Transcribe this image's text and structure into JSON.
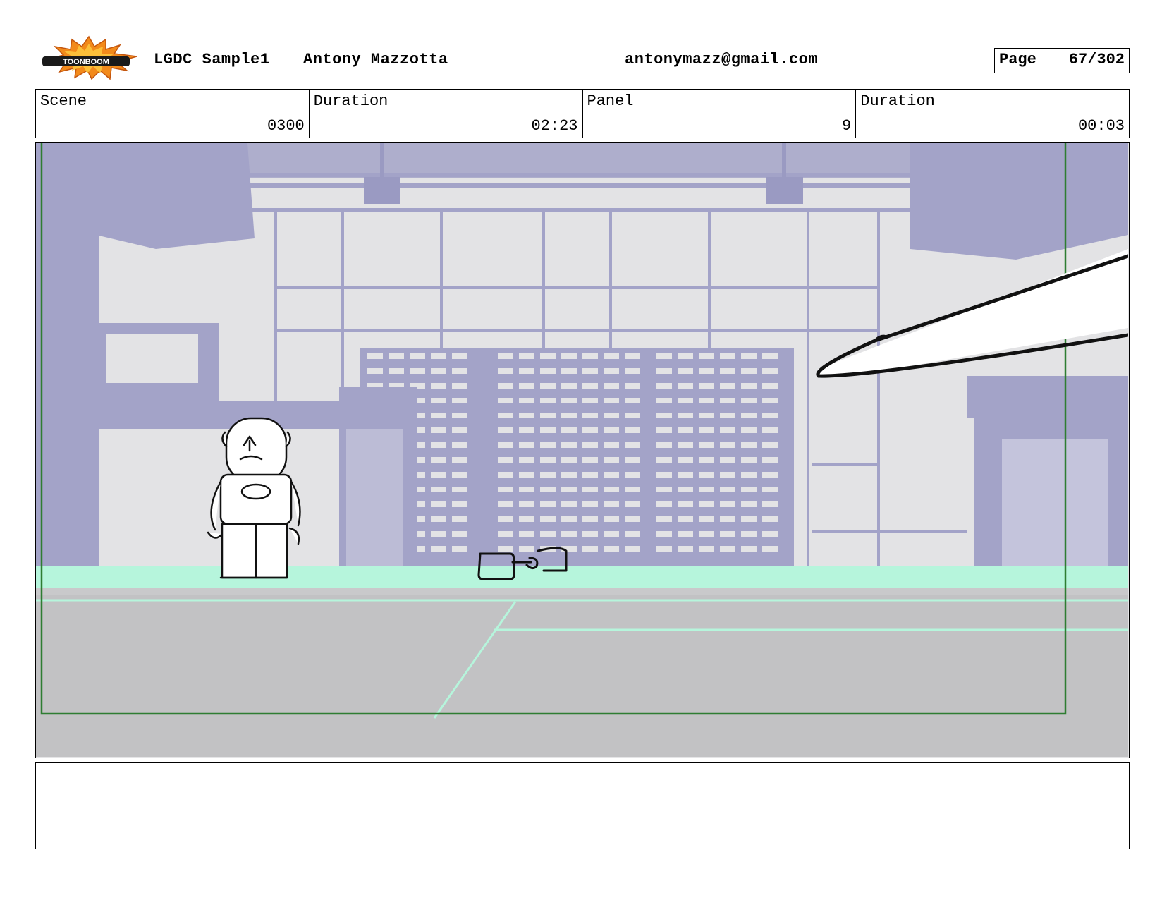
{
  "header": {
    "logo_text": "TOONBOOM",
    "project": "LGDC Sample1",
    "author": "Antony Mazzotta",
    "email": "antonymazz@gmail.com",
    "page_label": "Page",
    "page_value": "67/302"
  },
  "info": {
    "scene_label": "Scene",
    "scene_value": "0300",
    "scene_duration_label": "Duration",
    "scene_duration_value": "02:23",
    "panel_label": "Panel",
    "panel_value": "9",
    "panel_duration_label": "Duration",
    "panel_duration_value": "00:03"
  },
  "notes": {
    "text": ""
  },
  "colors": {
    "background_lines": "#a3a3c8",
    "floor": "#c2c2c4",
    "floor_highlight": "#b6f5dc",
    "safe_frame": "#2e7d32",
    "logo_orange": "#f28a1b"
  }
}
